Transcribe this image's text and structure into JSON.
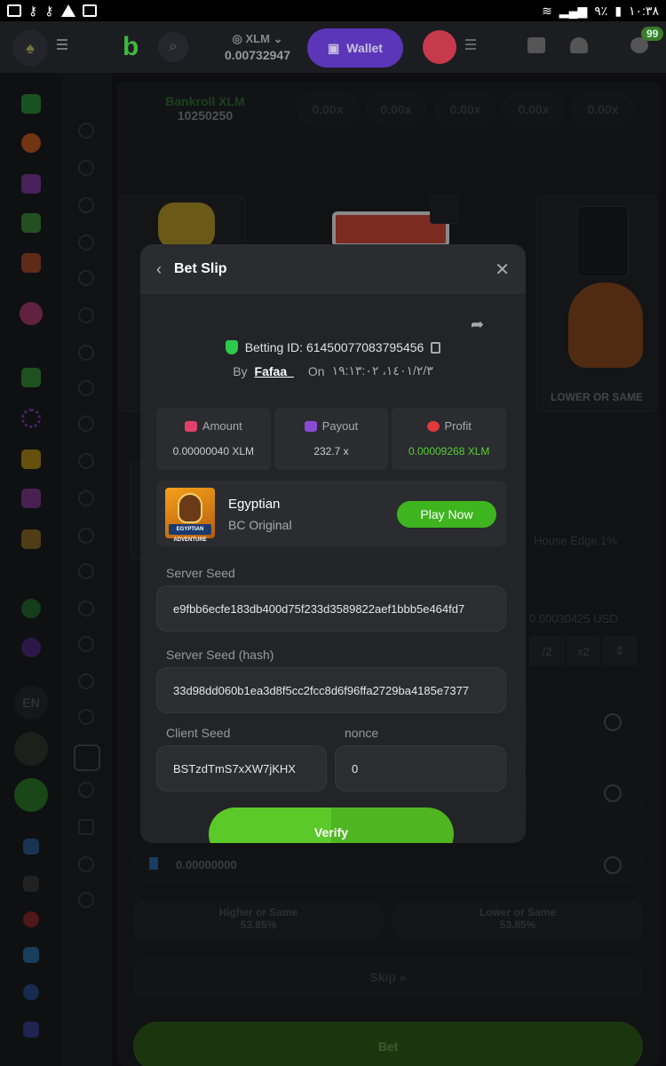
{
  "status_bar": {
    "battery": "٩٪",
    "time": "١٠:٣٨"
  },
  "header": {
    "currency": "XLM",
    "balance": "0.00732947",
    "wallet_label": "Wallet",
    "chat_badge": "99"
  },
  "sidebar": {
    "language": "EN"
  },
  "game": {
    "bankroll_label": "Bankroll XLM",
    "bankroll_value": "10250250",
    "multipliers": [
      "0.00x",
      "0.00x",
      "0.00x",
      "0.00x",
      "0.00x"
    ],
    "lower_or_same_card": "LOWER OR SAME",
    "house_edge": "House Edge 1%",
    "usd_value": "0.00030425 USD",
    "half_label": "/2",
    "double_label": "x2",
    "amount_value": "0.00000000",
    "higher_label": "Higher or Same",
    "higher_pct": "53.85%",
    "lower_label": "Lower or Same",
    "lower_pct": "53.85%",
    "skip_label": "Skip",
    "bet_label": "Bet"
  },
  "bet_slip": {
    "title": "Bet Slip",
    "betting_id": "Betting ID: 61450077083795456",
    "by_label": "By",
    "username": "Fafaa_",
    "on_label": "On",
    "date": "١٤٠١/٢/٣، ١٩:١٣:٠٢",
    "amount_label": "Amount",
    "amount_value": "0.00000040 XLM",
    "payout_label": "Payout",
    "payout_value": "232.7 x",
    "profit_label": "Profit",
    "profit_value": "0.00009268 XLM",
    "game_name": "Egyptian",
    "game_provider": "BC Original",
    "thumb_text": "EGYPTIAN ADVENTURE",
    "play_now": "Play Now",
    "server_seed_label": "Server Seed",
    "server_seed": "e9fbb6ecfe183db400d75f233d3589822aef1bbb5e464fd7",
    "server_seed_hash_label": "Server Seed (hash)",
    "server_seed_hash": "33d98dd060b1ea3d8f5cc2fcc8d6f96ffa2729ba4185e7377",
    "client_seed_label": "Client Seed",
    "client_seed": "BSTzdTmS7xXW7jKHX",
    "nonce_label": "nonce",
    "nonce": "0",
    "verify_label": "Verify"
  },
  "colors": {
    "accent_green": "#3eb51f",
    "profit_green": "#57d034",
    "wallet_purple": "#5b36b8"
  }
}
